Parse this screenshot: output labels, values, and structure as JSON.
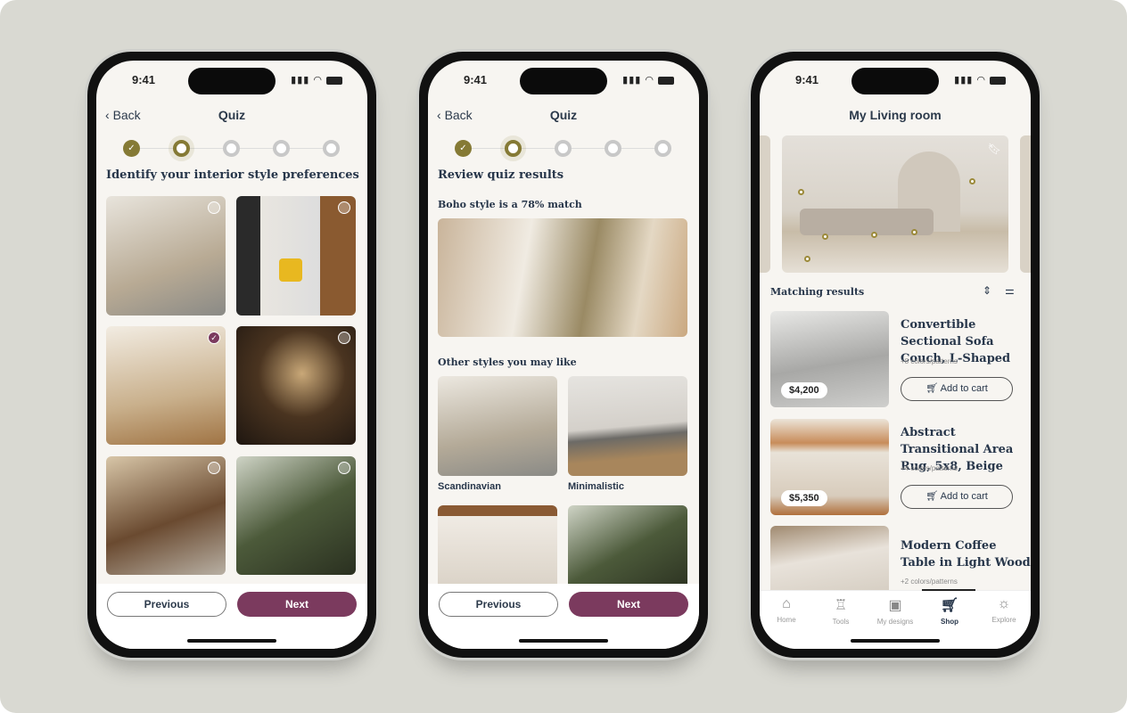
{
  "status": {
    "time": "9:41",
    "signal": "signal-icon",
    "wifi": "wifi-icon",
    "battery": "battery-icon"
  },
  "phone1": {
    "back": "Back",
    "title": "Quiz",
    "steps": [
      "done",
      "current",
      "todo",
      "todo",
      "todo"
    ],
    "heading": "Identify your interior style preferences",
    "images": [
      {
        "selected": false
      },
      {
        "selected": false
      },
      {
        "selected": true
      },
      {
        "selected": false
      },
      {
        "selected": false
      },
      {
        "selected": false
      }
    ],
    "previous": "Previous",
    "next": "Next"
  },
  "phone2": {
    "back": "Back",
    "title": "Quiz",
    "steps": [
      "done",
      "current",
      "todo",
      "todo",
      "todo"
    ],
    "heading": "Review quiz results",
    "match": "Boho style is a 78% match",
    "other": "Other styles you may like",
    "styles": [
      "Scandinavian",
      "Minimalistic"
    ],
    "previous": "Previous",
    "next": "Next"
  },
  "phone3": {
    "title": "My Living room",
    "matching": "Matching results",
    "products": [
      {
        "title": "Convertible Sectional Sofa Couch, L-Shaped",
        "sub": "+8 colors/patterns",
        "price": "$4,200",
        "cta": "Add to cart"
      },
      {
        "title": "Abstract Transitional Area Rug, 5x8, Beige",
        "sub": "+4 colors/patterns",
        "price": "$5,350",
        "cta": "Add to cart"
      },
      {
        "title": "Modern Coffee Table in Light Wood",
        "sub": "+2 colors/patterns"
      }
    ],
    "tabs": [
      {
        "label": "Home",
        "icon": "home-icon"
      },
      {
        "label": "Tools",
        "icon": "brush-icon"
      },
      {
        "label": "My designs",
        "icon": "image-icon"
      },
      {
        "label": "Shop",
        "icon": "cart-icon",
        "active": true
      },
      {
        "label": "Explore",
        "icon": "bulb-icon"
      }
    ]
  },
  "colors": {
    "accent": "#7b3a5e",
    "progress": "#857a35",
    "text": "#27364a"
  }
}
